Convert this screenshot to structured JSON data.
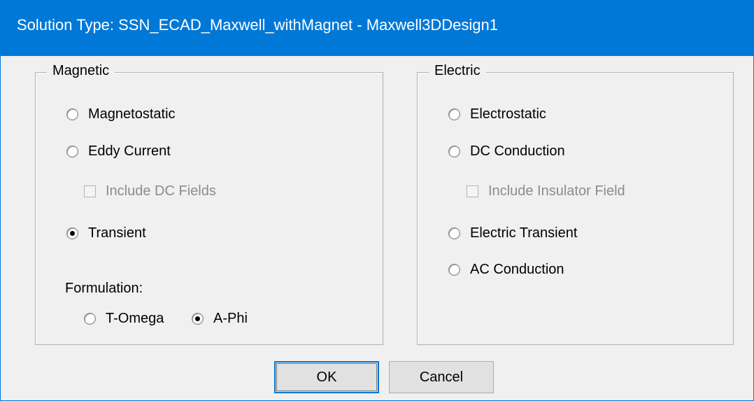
{
  "dialog": {
    "title": "Solution Type: SSN_ECAD_Maxwell_withMagnet - Maxwell3DDesign1"
  },
  "magnetic": {
    "legend": "Magnetic",
    "magnetostatic": "Magnetostatic",
    "eddy_current": "Eddy Current",
    "include_dc_fields": "Include DC Fields",
    "transient": "Transient",
    "formulation_label": "Formulation:",
    "t_omega": "T-Omega",
    "a_phi": "A-Phi",
    "selected": "Transient",
    "formulation_selected": "A-Phi"
  },
  "electric": {
    "legend": "Electric",
    "electrostatic": "Electrostatic",
    "dc_conduction": "DC Conduction",
    "include_insulator_field": "Include Insulator Field",
    "electric_transient": "Electric Transient",
    "ac_conduction": "AC Conduction"
  },
  "buttons": {
    "ok": "OK",
    "cancel": "Cancel"
  },
  "colors": {
    "titlebar": "#0078d7",
    "dialog_background": "#f0f0f0",
    "disabled_text": "#8c8c8c"
  }
}
